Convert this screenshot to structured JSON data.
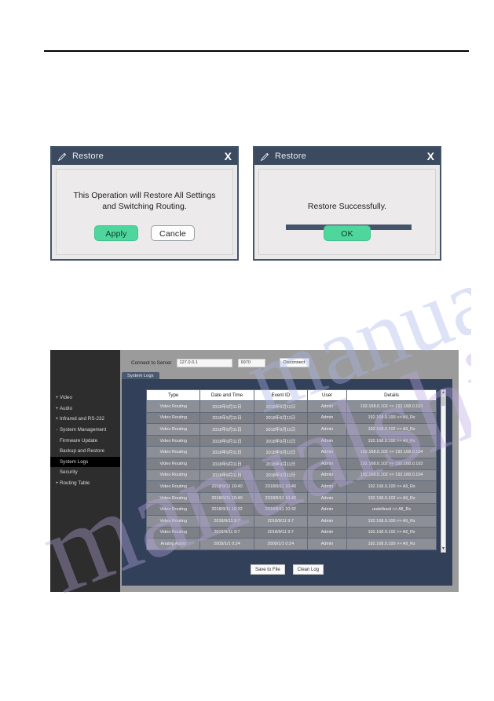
{
  "dialogs": [
    {
      "title": "Restore",
      "close_label": "X",
      "message_line1": "This Operation will Restore All Settings",
      "message_line2": "and Switching Routing.",
      "buttons": [
        {
          "label": "Apply",
          "style": "green"
        },
        {
          "label": "Cancle",
          "style": "white"
        }
      ],
      "has_progress": false
    },
    {
      "title": "Restore",
      "close_label": "X",
      "message_line1": "Restore Successfully.",
      "message_line2": "",
      "buttons": [
        {
          "label": "OK",
          "style": "green"
        }
      ],
      "has_progress": true
    }
  ],
  "app": {
    "sidebar": {
      "items": [
        {
          "twisty": "+",
          "label": "Video",
          "child": false,
          "active": false
        },
        {
          "twisty": "+",
          "label": "Audio",
          "child": false,
          "active": false
        },
        {
          "twisty": "+",
          "label": "Infrared and RS-232",
          "child": false,
          "active": false
        },
        {
          "twisty": "-",
          "label": "System Management",
          "child": false,
          "active": false
        },
        {
          "twisty": "",
          "label": "Firmware Update",
          "child": true,
          "active": false
        },
        {
          "twisty": "",
          "label": "Backup and Restore",
          "child": true,
          "active": false
        },
        {
          "twisty": "",
          "label": "System Logs",
          "child": true,
          "active": true
        },
        {
          "twisty": "",
          "label": "Security",
          "child": true,
          "active": false
        },
        {
          "twisty": "+",
          "label": "Routing Table",
          "child": false,
          "active": false
        }
      ]
    },
    "connection": {
      "label": "Connect to Server",
      "ip_value": "127.0.0.1",
      "port_value": "6970",
      "disconnect_label": "Disconnect"
    },
    "tabs": [
      {
        "label": "System Logs",
        "active": true
      }
    ],
    "table": {
      "headers": [
        "Type",
        "Date and Time",
        "Event ID",
        "User",
        "Details"
      ],
      "rows": [
        [
          "Video Routing",
          "2018年9月11日",
          "2018年9月11日",
          "Admin",
          "192.168.0.102 >> 192.168.0.103"
        ],
        [
          "Video Routing",
          "2018年9月11日",
          "2018年9月11日",
          "Admin",
          "192.168.0.100 >> All_Rx"
        ],
        [
          "Video Routing",
          "2018年9月11日",
          "2018年9月11日",
          "Admin",
          "192.168.0.102 >> All_Rx"
        ],
        [
          "Video Routing",
          "2018年9月11日",
          "2018年9月11日",
          "Admin",
          "192.168.0.100 >> All_Rx"
        ],
        [
          "Video Routing",
          "2018年9月11日",
          "2018年9月11日",
          "Admin",
          "192.168.0.102 >> 192.168.0.104"
        ],
        [
          "Video Routing",
          "2018年9月11日",
          "2018年9月11日",
          "Admin",
          "192.168.0.102 >> 192.168.0.103"
        ],
        [
          "Video Routing",
          "2018年9月11日",
          "2018年9月11日",
          "Admin",
          "192.168.0.102 >> 192.168.0.104"
        ],
        [
          "Video Routing",
          "2018/9/11 10:40",
          "2018/9/11 10:40",
          "Admin",
          "192.168.0.100 >> All_Rx"
        ],
        [
          "Video Routing",
          "2018/9/11 10:40",
          "2018/9/11 10:40",
          "Admin",
          "192.168.0.102 >> All_Rx"
        ],
        [
          "Video Routing",
          "2018/9/11 10:32",
          "2018/9/11 10:32",
          "Admin",
          "undefined >> All_Rx"
        ],
        [
          "Video Routing",
          "2018/9/11 9:7",
          "2018/9/11 9:7",
          "Admin",
          "192.168.0.100 >> All_Rx"
        ],
        [
          "Video Routing",
          "2018/9/11 9:7",
          "2018/9/11 9:7",
          "Admin",
          "192.168.0.102 >> All_Rx"
        ],
        [
          "Analog Audio",
          "2009/1/1 0:24",
          "2009/1/1 0:24",
          "Admin",
          "192.168.0.100 >> All_Rx"
        ]
      ]
    },
    "actions": [
      {
        "label": "Save to File"
      },
      {
        "label": "Clean Log"
      }
    ],
    "scrollbar": {
      "up": "▲",
      "down": "▼"
    }
  },
  "watermark": {
    "line_a": "manualshive.com",
    "line_b": "manualshive.com"
  }
}
